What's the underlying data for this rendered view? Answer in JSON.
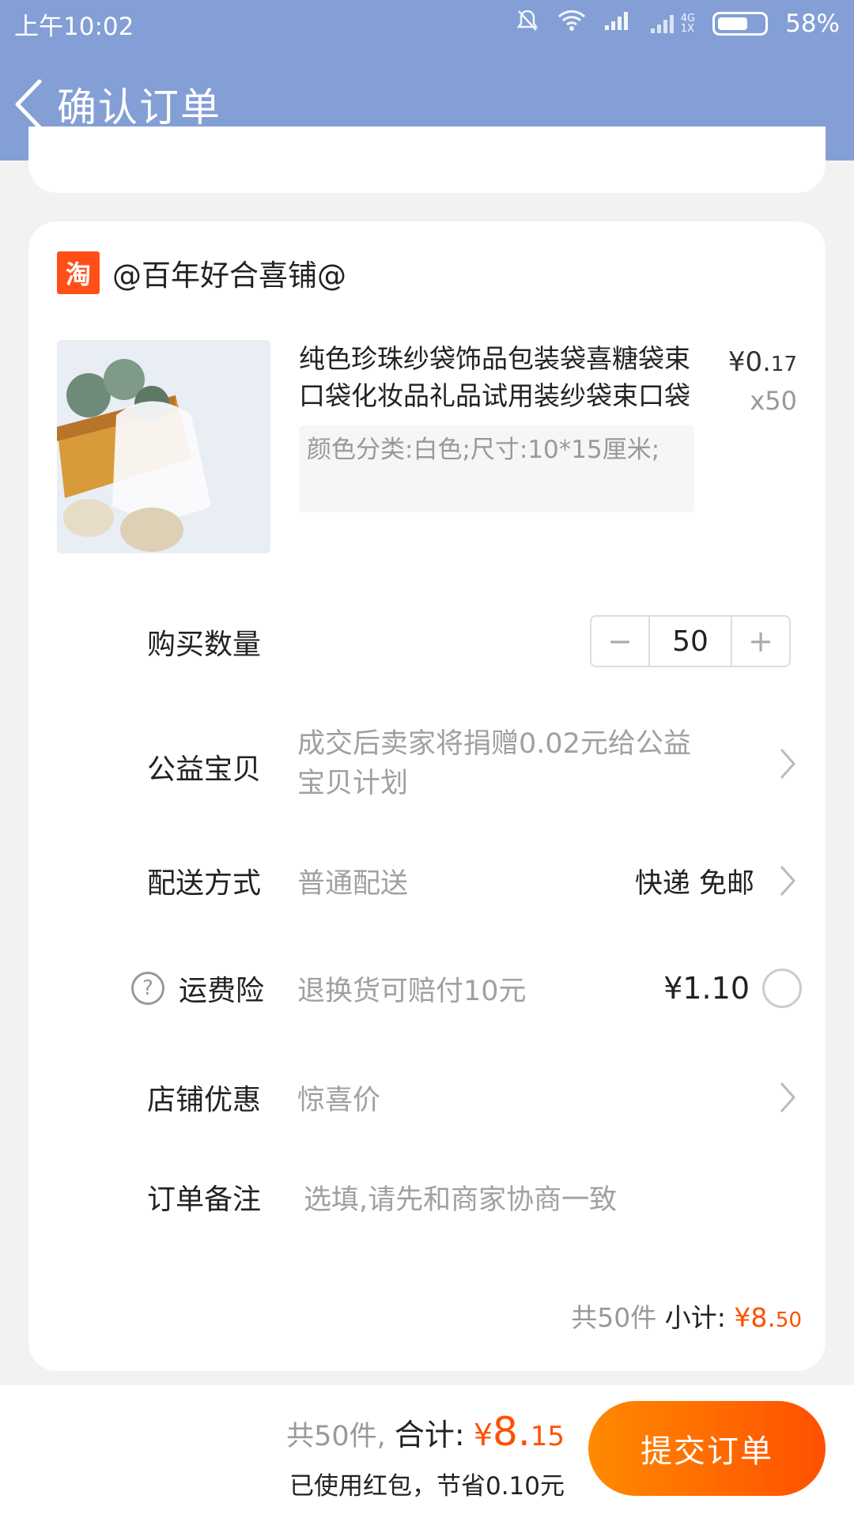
{
  "status_bar": {
    "time": "上午10:02",
    "network_4g": "4G",
    "network_1x": "1X",
    "battery": "58%"
  },
  "header": {
    "title": "确认订单"
  },
  "shop": {
    "logo_text": "淘",
    "name": "@百年好合喜铺@"
  },
  "product": {
    "title": "纯色珍珠纱袋饰品包装袋喜糖袋束口袋化妆品礼品试用装纱袋束口袋",
    "price_symbol": "¥",
    "price_int": "0.",
    "price_dec": "17",
    "quantity": "x50",
    "sku": "颜色分类:白色;尺寸:10*15厘米;"
  },
  "rows": {
    "qty_label": "购买数量",
    "qty_minus": "−",
    "qty_value": "50",
    "qty_plus": "+",
    "charity_label": "公益宝贝",
    "charity_value_line1": "成交后卖家将捐赠0.02元给公益",
    "charity_value_line2": "宝贝计划",
    "delivery_label": "配送方式",
    "delivery_value": "普通配送",
    "delivery_right": "快递 免邮",
    "insurance_help": "?",
    "insurance_label": "运费险",
    "insurance_value": "退换货可赔付10元",
    "insurance_price": "¥1.10",
    "discount_label": "店铺优惠",
    "discount_value": "惊喜价",
    "note_label": "订单备注",
    "note_placeholder": "选填,请先和商家协商一致"
  },
  "subtotal": {
    "count": "共50件",
    "label": "小计:",
    "symbol": "¥",
    "int": "8.",
    "dec": "50"
  },
  "bottom": {
    "count": "共50件,",
    "label": "合计:",
    "symbol": "¥",
    "int": "8.",
    "dec": "15",
    "saved": "已使用红包，节省0.10元",
    "submit": "提交订单"
  },
  "colors": {
    "header_bg": "#839fd6",
    "accent": "#ff5000",
    "taobao_logo": "#ff4f17"
  }
}
